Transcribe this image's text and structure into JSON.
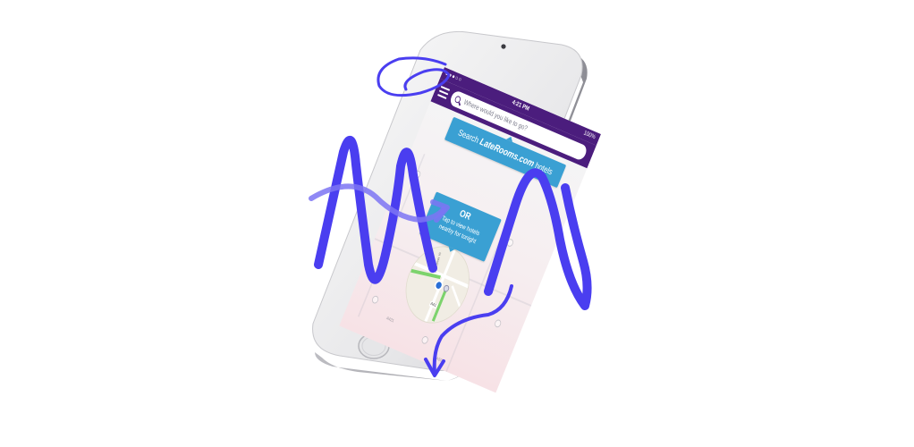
{
  "status_bar": {
    "carrier": "●●●○○",
    "time": "4:21 PM",
    "battery": "100%"
  },
  "header": {
    "menu_icon": "hamburger-icon",
    "search_icon": "magnifier-icon",
    "search_placeholder": "Where would you like to go?"
  },
  "search_banner": {
    "prefix": "Search ",
    "brand": "LateRooms.com",
    "suffix": " hotels"
  },
  "nearby": {
    "or_label": "OR",
    "text": "Tap to view hotels nearby for tonight",
    "road_label": "A41",
    "street_label": "St. Mark's Rd"
  },
  "map_labels": {
    "label_1": "A421",
    "label_2": "A500"
  },
  "colors": {
    "header_purple": "#4b1d7d",
    "banner_blue": "#3aa0d3",
    "annotation_blue": "#4a3ef0",
    "route_green": "#7cd36c"
  }
}
